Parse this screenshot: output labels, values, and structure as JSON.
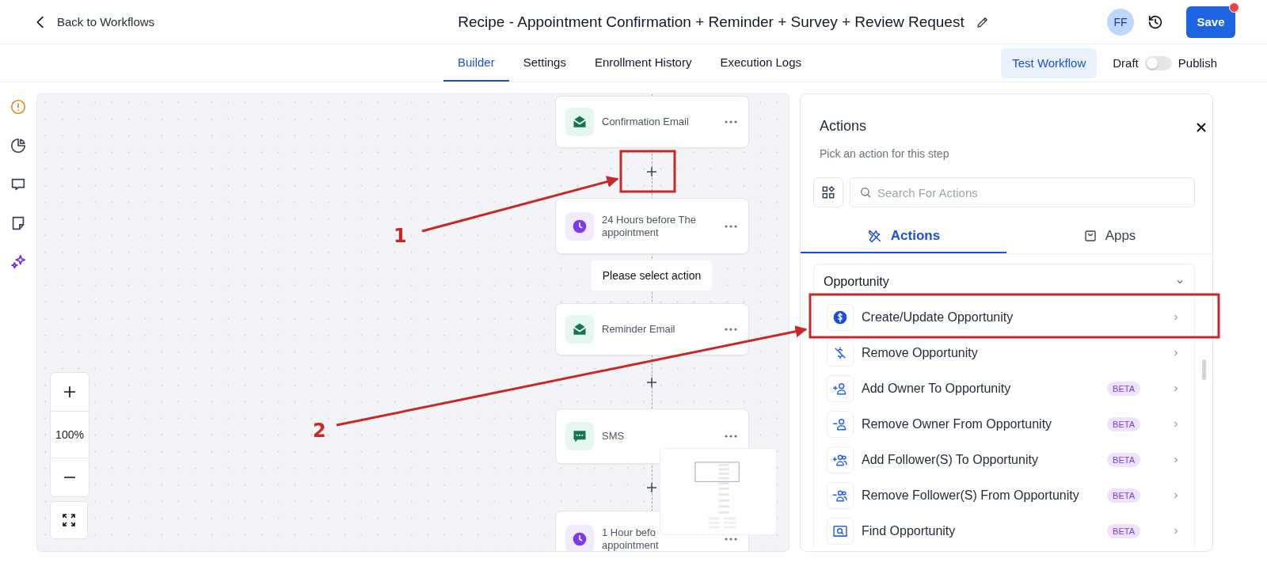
{
  "header": {
    "back_link": "Back to Workflows",
    "title": "Recipe - Appointment Confirmation + Reminder + Survey + Review Request",
    "avatar": "FF",
    "save_button": "Save"
  },
  "nav_tabs": [
    {
      "label": "Builder",
      "selected": true
    },
    {
      "label": "Settings",
      "selected": false
    },
    {
      "label": "Enrollment History",
      "selected": false
    },
    {
      "label": "Execution Logs",
      "selected": false
    }
  ],
  "test_button": "Test Workflow",
  "publish_toggle": {
    "off_label": "Draft",
    "on_label": "Publish",
    "on": false
  },
  "side_rail": [
    {
      "kind": "warning"
    },
    {
      "kind": "chart"
    },
    {
      "kind": "comment"
    },
    {
      "kind": "note"
    },
    {
      "kind": "sparkle"
    }
  ],
  "canvas": {
    "nodes": [
      {
        "kind": "email",
        "lines": [
          "Confirmation Email"
        ]
      },
      {
        "kind": "add"
      },
      {
        "kind": "wait",
        "lines": [
          "24 Hours before The",
          "appointment"
        ]
      },
      {
        "kind": "label",
        "text": "Please select action"
      },
      {
        "kind": "email",
        "lines": [
          "Reminder Email"
        ]
      },
      {
        "kind": "add"
      },
      {
        "kind": "sms",
        "lines": [
          "SMS"
        ]
      },
      {
        "kind": "add"
      },
      {
        "kind": "wait",
        "lines": [
          "1 Hour befo",
          "appointment"
        ]
      }
    ],
    "zoom_level": "100%"
  },
  "panel": {
    "title": "Actions",
    "subtitle": "Pick an action for this step",
    "search": {
      "placeholder": "Search For Actions"
    },
    "tabs": [
      {
        "label": "Actions",
        "kind": "actions",
        "selected": true
      },
      {
        "label": "Apps",
        "kind": "apps",
        "selected": false
      }
    ],
    "group": {
      "title": "Opportunity",
      "expanded": true,
      "items": [
        {
          "label": "Create/Update Opportunity",
          "kind": "dollar"
        },
        {
          "label": "Remove Opportunity",
          "kind": "remove-dollar"
        },
        {
          "label": "Add Owner To Opportunity",
          "kind": "add-person",
          "badge": "BETA"
        },
        {
          "label": "Remove Owner From Opportunity",
          "kind": "remove-person",
          "badge": "BETA"
        },
        {
          "label": "Add Follower(S) To Opportunity",
          "kind": "add-people",
          "badge": "BETA"
        },
        {
          "label": "Remove Follower(S) From Opportunity",
          "kind": "remove-people",
          "badge": "BETA"
        },
        {
          "label": "Find Opportunity",
          "kind": "find",
          "badge": "BETA"
        }
      ]
    }
  },
  "annotations": [
    {
      "label": "1"
    },
    {
      "label": "2"
    }
  ]
}
